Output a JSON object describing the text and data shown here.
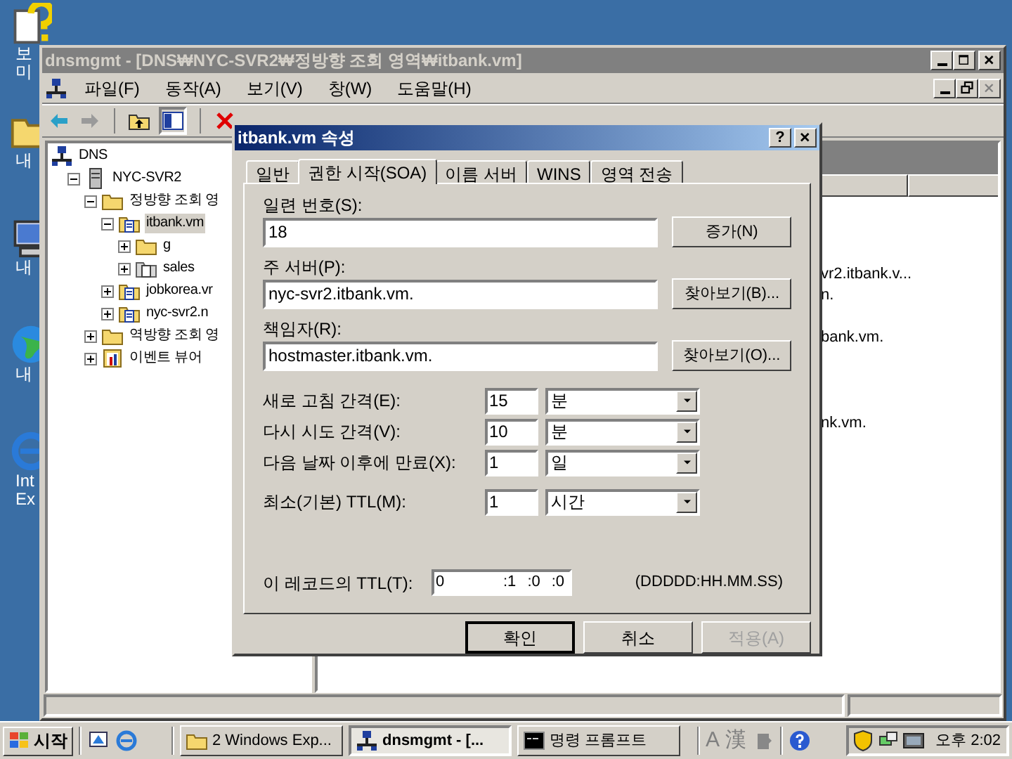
{
  "desktop_icons": [
    {
      "kind": "help",
      "lines": [
        "보",
        "미"
      ]
    },
    {
      "kind": "folder",
      "lines": [
        "내"
      ]
    },
    {
      "kind": "computer",
      "lines": [
        "내"
      ]
    },
    {
      "kind": "globe",
      "lines": [
        "내"
      ]
    },
    {
      "kind": "browser",
      "lines": [
        "Int",
        "Ex"
      ]
    }
  ],
  "window": {
    "title": "dnsmgmt - [DNS₩NYC-SVR2₩정방향 조회 영역₩itbank.vm]",
    "menu": [
      "파일(F)",
      "동작(A)",
      "보기(V)",
      "창(W)",
      "도움말(H)"
    ],
    "tree": [
      {
        "label": "DNS",
        "kind": "dns",
        "selected": false,
        "children": [
          {
            "label": "NYC-SVR2",
            "kind": "server",
            "expanded": true,
            "selected": false,
            "children": [
              {
                "label": "정방향 조회 영",
                "kind": "folder",
                "expanded": true,
                "selected": false,
                "children": [
                  {
                    "label": "itbank.vm",
                    "kind": "zone",
                    "expanded": true,
                    "selected": true,
                    "children": [
                      {
                        "label": "g",
                        "kind": "folder",
                        "expanded": false,
                        "selected": false
                      },
                      {
                        "label": "sales",
                        "kind": "zone-gray",
                        "expanded": false,
                        "selected": false
                      }
                    ]
                  },
                  {
                    "label": "jobkorea.vr",
                    "kind": "zone",
                    "expanded": false,
                    "selected": false
                  },
                  {
                    "label": "nyc-svr2.n",
                    "kind": "zone",
                    "expanded": false,
                    "selected": false
                  }
                ]
              },
              {
                "label": "역방향 조회 영",
                "kind": "folder",
                "expanded": false,
                "selected": false
              },
              {
                "label": "이벤트 뷰어",
                "kind": "event",
                "expanded": false,
                "selected": false
              }
            ]
          }
        ]
      }
    ],
    "list_texts": [
      "vr2.itbank.v...",
      "n.",
      "bank.vm.",
      "nk.vm."
    ]
  },
  "dialog": {
    "title": "itbank.vm 속성",
    "help": "?",
    "tabs": [
      {
        "label": "일반",
        "selected": false
      },
      {
        "label": "권한 시작(SOA)",
        "selected": true
      },
      {
        "label": "이름 서버",
        "selected": false
      },
      {
        "label": "WINS",
        "selected": false
      },
      {
        "label": "영역 전송",
        "selected": false
      }
    ],
    "fields": [
      {
        "label": "일련 번호(S):",
        "value": "18",
        "button": "증가(N)"
      },
      {
        "label": "주 서버(P):",
        "value": "nyc-svr2.itbank.vm.",
        "button": "찾아보기(B)..."
      },
      {
        "label": "책임자(R):",
        "value": "hostmaster.itbank.vm.",
        "button": "찾아보기(O)..."
      }
    ],
    "intervals": [
      {
        "label": "새로 고침 간격(E):",
        "value": "15",
        "unit": "분"
      },
      {
        "label": "다시 시도 간격(V):",
        "value": "10",
        "unit": "분"
      },
      {
        "label": "다음 날짜 이후에 만료(X):",
        "value": "1",
        "unit": "일"
      },
      {
        "label": "최소(기본) TTL(M):",
        "value": "1",
        "unit": "시간"
      }
    ],
    "record_ttl": {
      "label": "이 레코드의 TTL(T):",
      "parts": [
        "0",
        ":1",
        ":0",
        ":0"
      ],
      "format": "(DDDDD:HH.MM.SS)"
    },
    "buttons": [
      {
        "label": "확인",
        "default": true,
        "disabled": false
      },
      {
        "label": "취소",
        "default": false,
        "disabled": false
      },
      {
        "label": "적용(A)",
        "default": false,
        "disabled": true
      }
    ]
  },
  "taskbar": {
    "start": "시작",
    "tasks": [
      {
        "label": "2 Windows Exp...",
        "kind": "folder",
        "selected": false
      },
      {
        "label": "dnsmgmt - [...",
        "kind": "dns",
        "selected": true
      },
      {
        "label": "명령 프롬프트",
        "kind": "console",
        "selected": false
      }
    ],
    "language": [
      "A",
      "漢"
    ],
    "clock": "오후 2:02"
  }
}
